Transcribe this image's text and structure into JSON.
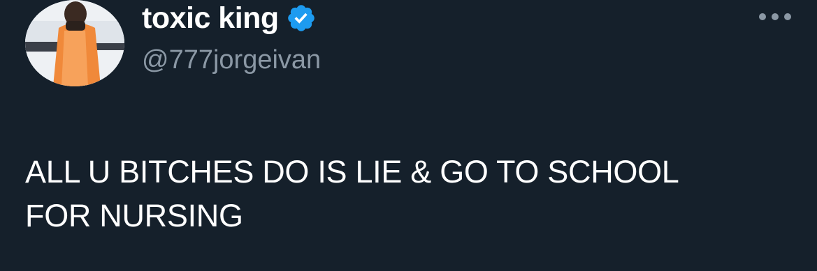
{
  "author": {
    "display_name": "toxic king",
    "handle": "@777jorgeivan",
    "verified_icon": "verified-badge-icon",
    "avatar_icon": "profile-avatar"
  },
  "menu": {
    "icon": "more-options-icon"
  },
  "tweet": {
    "lines": [
      "ALL U BITCHES DO IS LIE & GO TO SCHOOL",
      "FOR NURSING"
    ]
  },
  "colors": {
    "background": "#15202b",
    "primary_text": "#ffffff",
    "secondary_text": "#8b98a5",
    "verified_blue": "#1d9bf0"
  }
}
